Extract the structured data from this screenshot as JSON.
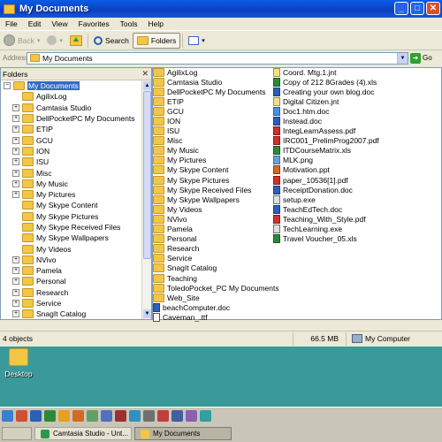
{
  "window": {
    "title": "My Documents"
  },
  "menu": [
    "File",
    "Edit",
    "View",
    "Favorites",
    "Tools",
    "Help"
  ],
  "toolbar": {
    "back": "Back",
    "search": "Search",
    "folders": "Folders"
  },
  "address": {
    "label": "Address",
    "value": "My Documents",
    "go": "Go"
  },
  "folders_pane": {
    "header": "Folders",
    "tree": [
      {
        "label": "My Documents",
        "expander": "-",
        "selected": true,
        "indent": 0
      },
      {
        "label": "AgilixLog",
        "expander": "",
        "indent": 1
      },
      {
        "label": "Camtasia Studio",
        "expander": "+",
        "indent": 1
      },
      {
        "label": "DellPocketPC My Documents",
        "expander": "+",
        "indent": 1
      },
      {
        "label": "ETIP",
        "expander": "+",
        "indent": 1
      },
      {
        "label": "GCU",
        "expander": "+",
        "indent": 1
      },
      {
        "label": "ION",
        "expander": "+",
        "indent": 1
      },
      {
        "label": "ISU",
        "expander": "+",
        "indent": 1
      },
      {
        "label": "Misc",
        "expander": "+",
        "indent": 1
      },
      {
        "label": "My Music",
        "expander": "+",
        "indent": 1
      },
      {
        "label": "My Pictures",
        "expander": "+",
        "indent": 1
      },
      {
        "label": "My Skype Content",
        "expander": "",
        "indent": 1
      },
      {
        "label": "My Skype Pictures",
        "expander": "",
        "indent": 1
      },
      {
        "label": "My Skype Received Files",
        "expander": "",
        "indent": 1
      },
      {
        "label": "My Skype Wallpapers",
        "expander": "",
        "indent": 1
      },
      {
        "label": "My Videos",
        "expander": "",
        "indent": 1
      },
      {
        "label": "NVivo",
        "expander": "+",
        "indent": 1
      },
      {
        "label": "Pamela",
        "expander": "+",
        "indent": 1
      },
      {
        "label": "Personal",
        "expander": "+",
        "indent": 1
      },
      {
        "label": "Research",
        "expander": "+",
        "indent": 1
      },
      {
        "label": "Service",
        "expander": "+",
        "indent": 1
      },
      {
        "label": "SnagIt Catalog",
        "expander": "+",
        "indent": 1
      }
    ]
  },
  "files_col1": [
    {
      "name": "AgilixLog",
      "type": "folder"
    },
    {
      "name": "Camtasia Studio",
      "type": "folder"
    },
    {
      "name": "DellPocketPC My Documents",
      "type": "folder"
    },
    {
      "name": "ETIP",
      "type": "folder"
    },
    {
      "name": "GCU",
      "type": "folder"
    },
    {
      "name": "ION",
      "type": "folder"
    },
    {
      "name": "ISU",
      "type": "folder"
    },
    {
      "name": "Misc",
      "type": "folder"
    },
    {
      "name": "My Music",
      "type": "folder"
    },
    {
      "name": "My Pictures",
      "type": "folder"
    },
    {
      "name": "My Skype Content",
      "type": "folder"
    },
    {
      "name": "My Skype Pictures",
      "type": "folder"
    },
    {
      "name": "My Skype Received Files",
      "type": "folder"
    },
    {
      "name": "My Skype Wallpapers",
      "type": "folder"
    },
    {
      "name": "My Videos",
      "type": "folder"
    },
    {
      "name": "NVivo",
      "type": "folder"
    },
    {
      "name": "Pamela",
      "type": "folder"
    },
    {
      "name": "Personal",
      "type": "folder"
    },
    {
      "name": "Research",
      "type": "folder"
    },
    {
      "name": "Service",
      "type": "folder"
    },
    {
      "name": "SnagIt Catalog",
      "type": "folder"
    },
    {
      "name": "Teaching",
      "type": "folder"
    },
    {
      "name": "ToledoPocket_PC My Documents",
      "type": "folder"
    },
    {
      "name": "Web_Site",
      "type": "folder"
    },
    {
      "name": "beachComputer.doc",
      "type": "doc"
    },
    {
      "name": "Caveman_.ttf",
      "type": "ttf"
    }
  ],
  "files_col2": [
    {
      "name": "Coord. Mtg.1.jnt",
      "type": "jnt"
    },
    {
      "name": "Copy of 212 8Grades (4).xls",
      "type": "xls"
    },
    {
      "name": "Creating your own blog.doc",
      "type": "doc"
    },
    {
      "name": "Digital Citizen.jnt",
      "type": "jnt"
    },
    {
      "name": "Doc1.htm.doc",
      "type": "htm"
    },
    {
      "name": "Instead.doc",
      "type": "doc"
    },
    {
      "name": "IntegLearnAssess.pdf",
      "type": "pdf"
    },
    {
      "name": "IRC001_PrelimProg2007.pdf",
      "type": "pdf"
    },
    {
      "name": "ITDCourseMatrix.xls",
      "type": "xls"
    },
    {
      "name": "MLK.png",
      "type": "png"
    },
    {
      "name": "Motivation.ppt",
      "type": "ppt"
    },
    {
      "name": "paper_10536[1].pdf",
      "type": "pdf"
    },
    {
      "name": "ReceiptDonation.doc",
      "type": "doc"
    },
    {
      "name": "setup.exe",
      "type": "exe"
    },
    {
      "name": "TeachEdTech.doc",
      "type": "doc"
    },
    {
      "name": "Teaching_With_Style.pdf",
      "type": "pdf"
    },
    {
      "name": "TechLearning.exe",
      "type": "exe"
    },
    {
      "name": "Travel Voucher_05.xls",
      "type": "xls"
    }
  ],
  "status": {
    "objects": "4 objects",
    "size": "66.5 MB",
    "location": "My Computer"
  },
  "desktop": {
    "icon_label": "Desktop"
  },
  "taskbar": {
    "tasks": [
      {
        "label": "Camtasia Studio - Unt...",
        "active": false
      },
      {
        "label": "My Documents",
        "active": true
      }
    ]
  },
  "colors": {
    "title_bar": "#0a5ce6",
    "window_bg": "#ece9d8",
    "desktop_bg": "#3a9a9a",
    "selection": "#316ac5"
  }
}
